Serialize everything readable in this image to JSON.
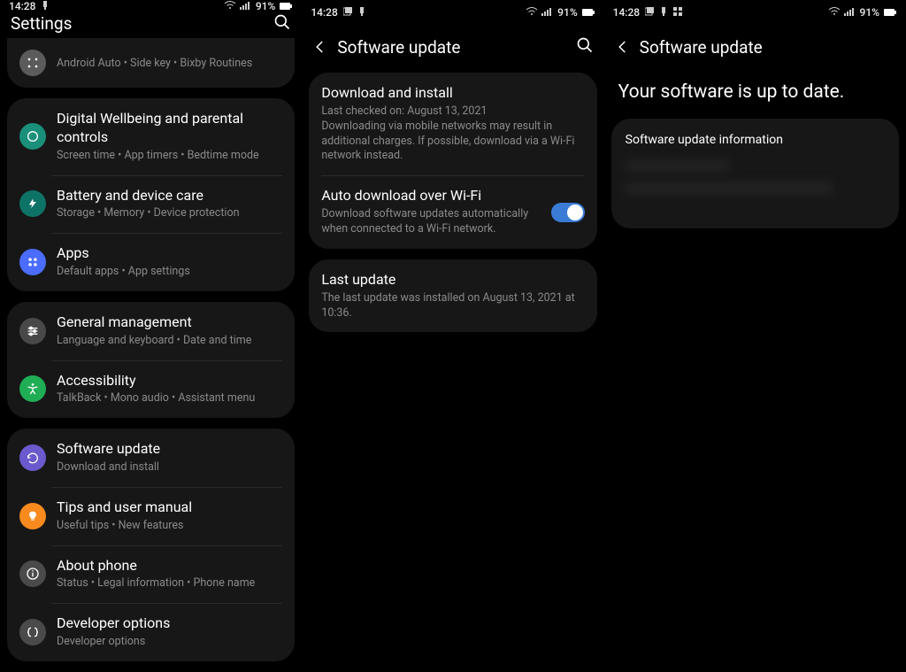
{
  "status": {
    "time": "14:28",
    "battery_text": "91%"
  },
  "screen1": {
    "title": "Settings",
    "groups": [
      {
        "top_cut": true,
        "items": [
          {
            "icon": "advanced",
            "color": "ic-grey",
            "title": "",
            "sub": "Android Auto  •  Side key  •  Bixby Routines"
          }
        ]
      },
      {
        "items": [
          {
            "icon": "wellbeing",
            "color": "ic-teal",
            "title": "Digital Wellbeing and parental controls",
            "sub": "Screen time  •  App timers  •  Bedtime mode"
          },
          {
            "icon": "battery",
            "color": "ic-dteal",
            "title": "Battery and device care",
            "sub": "Storage  •  Memory  •  Device protection"
          },
          {
            "icon": "apps",
            "color": "ic-blue",
            "title": "Apps",
            "sub": "Default apps  •  App settings"
          }
        ]
      },
      {
        "items": [
          {
            "icon": "general",
            "color": "ic-dgrey",
            "title": "General management",
            "sub": "Language and keyboard  •  Date and time"
          },
          {
            "icon": "accessibility",
            "color": "ic-green",
            "title": "Accessibility",
            "sub": "TalkBack  •  Mono audio  •  Assistant menu"
          }
        ]
      },
      {
        "items": [
          {
            "icon": "update",
            "color": "ic-purple",
            "title": "Software update",
            "sub": "Download and install"
          },
          {
            "icon": "tips",
            "color": "ic-orange",
            "title": "Tips and user manual",
            "sub": "Useful tips  •  New features"
          },
          {
            "icon": "about",
            "color": "ic-sgrey",
            "title": "About phone",
            "sub": "Status  •  Legal information  •  Phone name"
          },
          {
            "icon": "dev",
            "color": "ic-sgrey",
            "title": "Developer options",
            "sub": "Developer options"
          }
        ]
      }
    ]
  },
  "screen2": {
    "title": "Software update",
    "groups": [
      {
        "items": [
          {
            "title": "Download and install",
            "sub": "Last checked on: August 13, 2021\nDownloading via mobile networks may result in additional charges. If possible, download via a Wi-Fi network instead."
          },
          {
            "title": "Auto download over Wi-Fi",
            "sub": "Download software updates automatically when connected to a Wi-Fi network.",
            "toggle": true
          }
        ]
      },
      {
        "items": [
          {
            "title": "Last update",
            "sub": "The last update was installed on August 13, 2021 at 10:36."
          }
        ]
      }
    ]
  },
  "screen3": {
    "title": "Software update",
    "headline": "Your software is up to date.",
    "info_label": "Software update information"
  }
}
